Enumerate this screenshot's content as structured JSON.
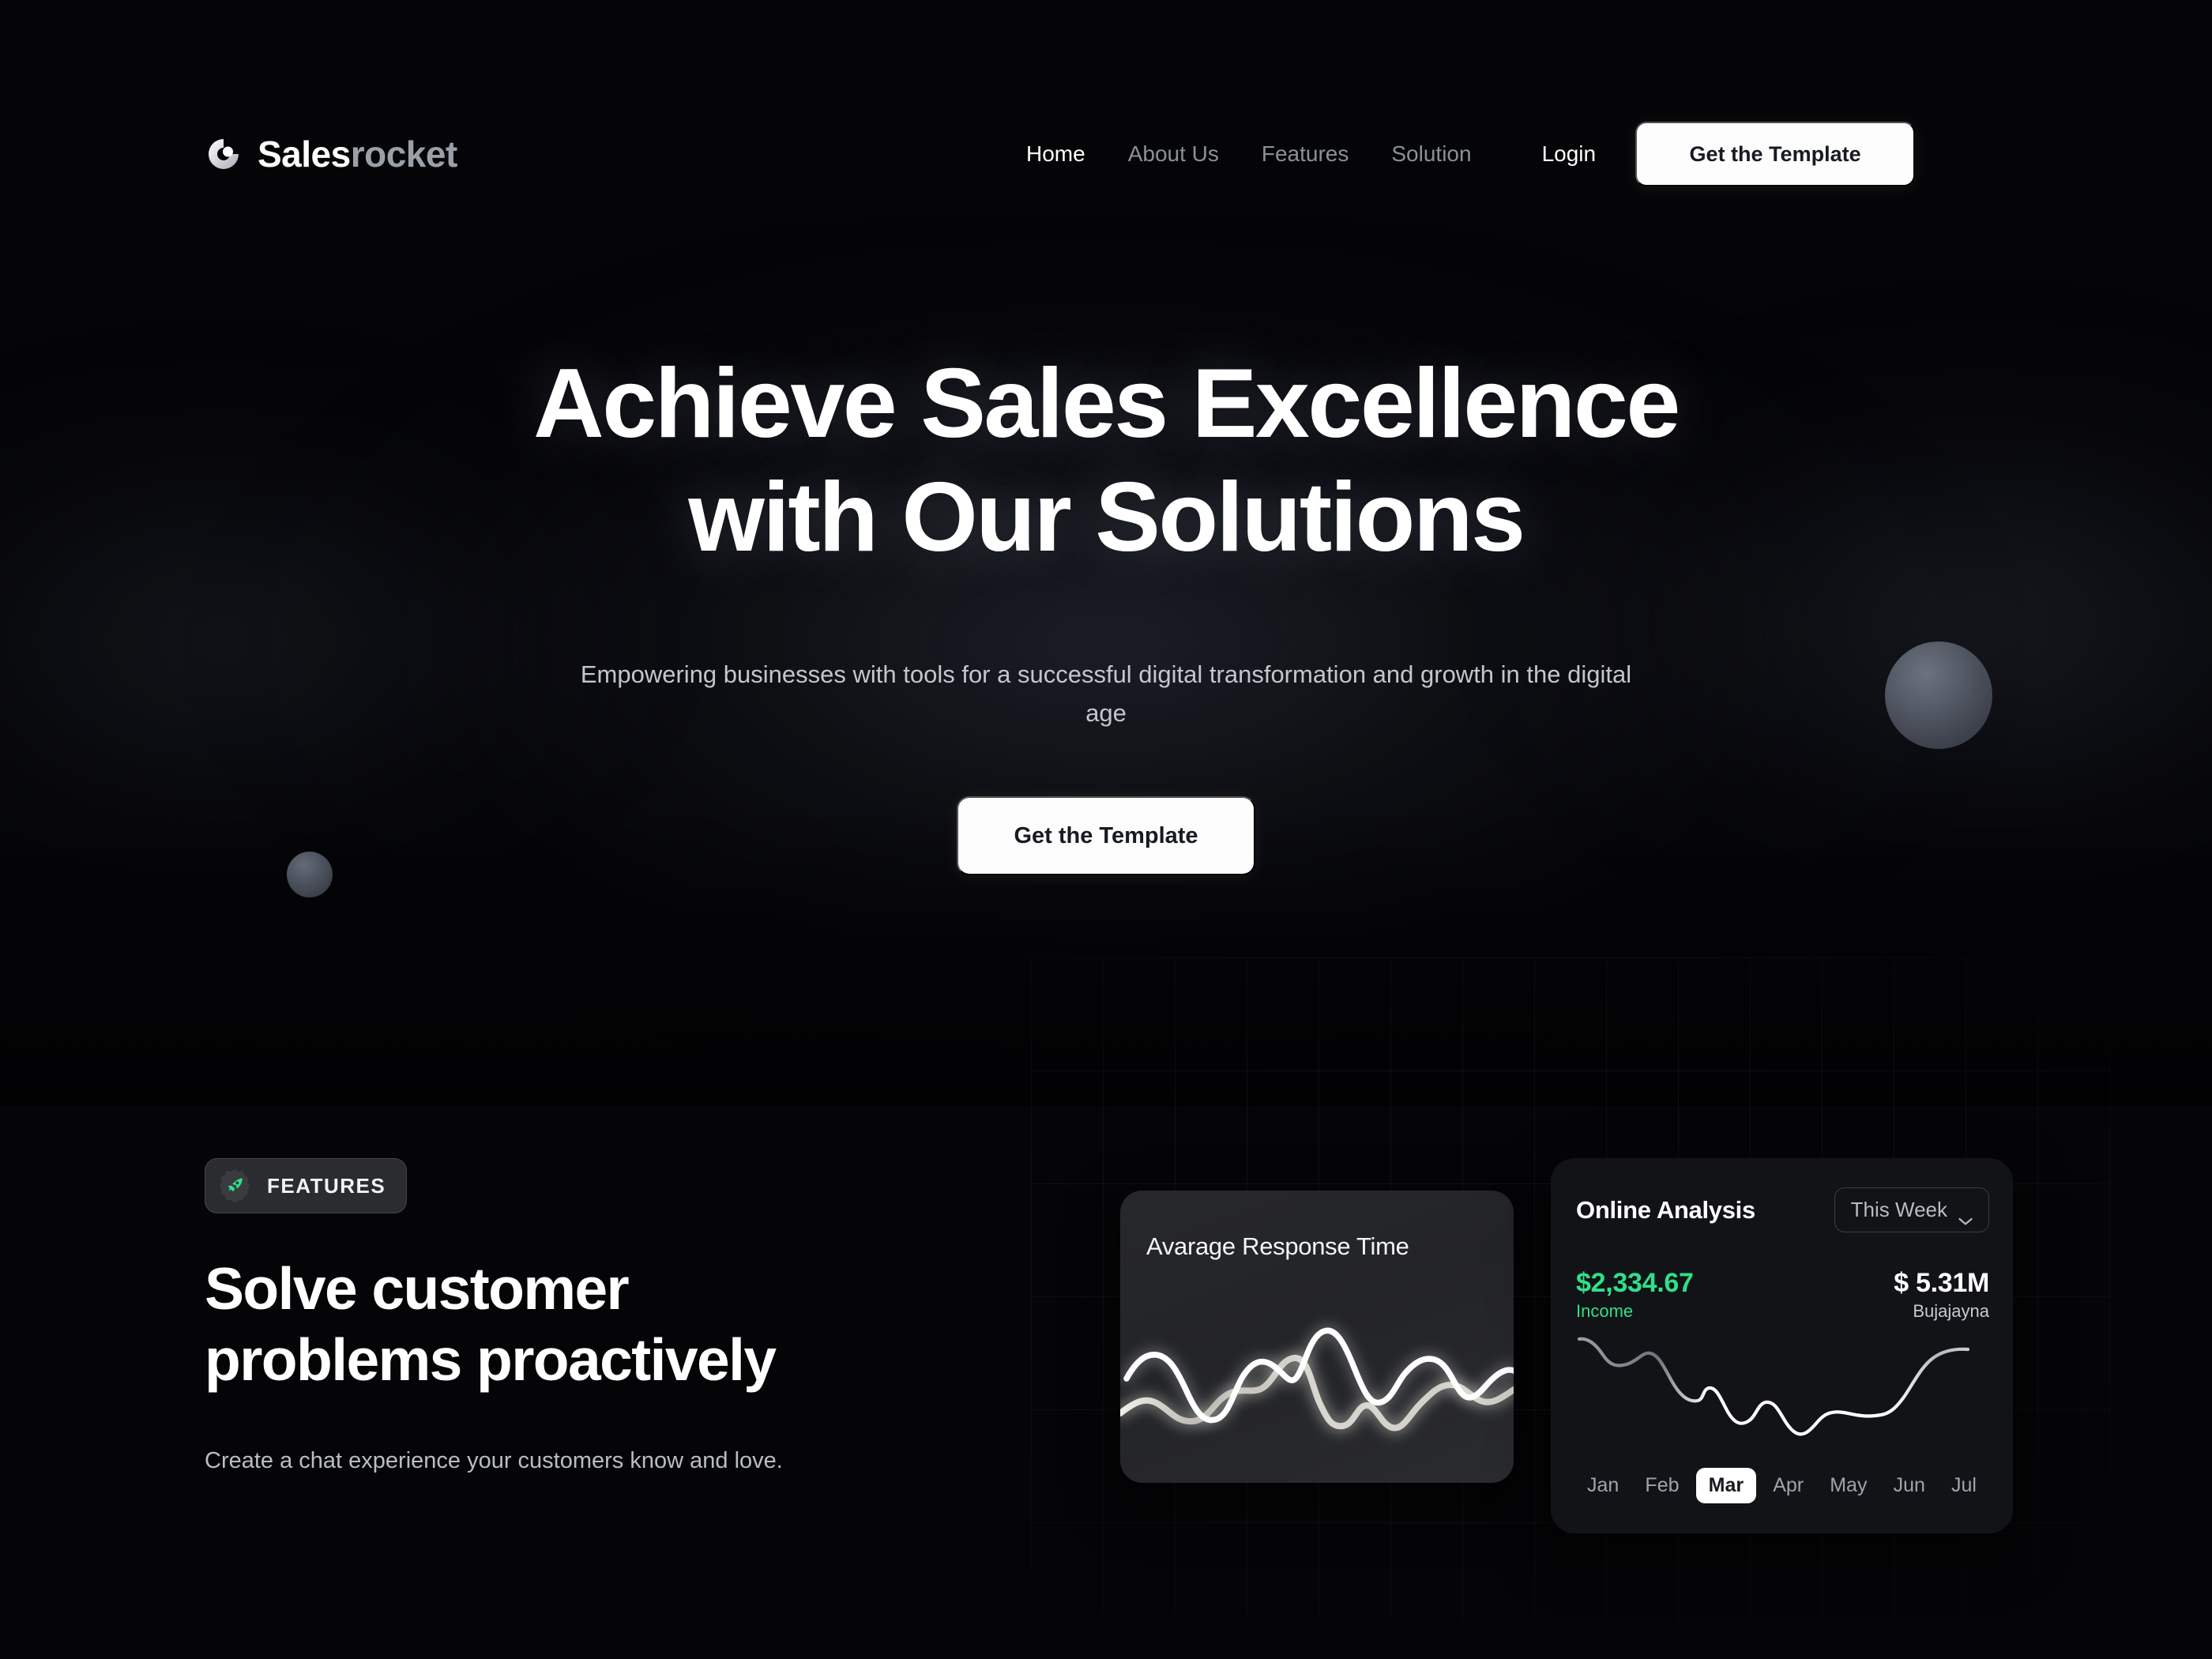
{
  "brand": {
    "name_primary": "Sales",
    "name_secondary": "rocket",
    "logo_icon": "rocket-circle-icon"
  },
  "nav": {
    "items": [
      {
        "label": "Home",
        "active": true
      },
      {
        "label": "About Us",
        "active": false
      },
      {
        "label": "Features",
        "active": false
      },
      {
        "label": "Solution",
        "active": false
      }
    ],
    "login_label": "Login",
    "cta_label": "Get the Template"
  },
  "hero": {
    "title_line1": "Achieve Sales Excellence",
    "title_line2": "with Our Solutions",
    "subtitle": "Empowering businesses with tools for a successful digital transformation and growth in the digital age",
    "cta_label": "Get the Template"
  },
  "features": {
    "badge_label": "FEATURES",
    "badge_icon": "rocket-icon",
    "title_line1": "Solve customer",
    "title_line2": "problems proactively",
    "description": "Create a chat experience your customers know and love."
  },
  "cards": {
    "response": {
      "title": "Avarage Response Time"
    },
    "analysis": {
      "title": "Online Analysis",
      "range_label": "This Week",
      "range_icon": "chevron-down-icon",
      "income_value": "$2,334.67",
      "income_label": "Income",
      "secondary_value": "$ 5.31M",
      "secondary_label": "Bujajayna",
      "months": [
        "Jan",
        "Feb",
        "Mar",
        "Apr",
        "May",
        "Jun",
        "Jul"
      ],
      "active_month": "Mar"
    }
  },
  "colors": {
    "background": "#050507",
    "accent_green": "#2fe08a",
    "text_primary": "#ffffff",
    "text_muted": "#8b9097",
    "button_bg": "#fdfdfd",
    "button_text": "#171a22",
    "card_dark": "#121317",
    "card_gray": "#27282b"
  },
  "chart_data": [
    {
      "type": "line",
      "title": "Avarage Response Time",
      "xlabel": "",
      "ylabel": "",
      "grid": false,
      "legend": "none",
      "series": [
        {
          "name": "white-wave",
          "values": [
            42,
            34,
            72,
            78,
            60,
            52,
            18,
            20,
            52,
            38,
            66,
            30,
            44,
            34,
            42
          ]
        },
        {
          "name": "gray-wave",
          "values": [
            70,
            64,
            80,
            66,
            60,
            44,
            86,
            80,
            94,
            82,
            70,
            58,
            72,
            58,
            50
          ]
        }
      ],
      "ylim": [
        0,
        100
      ]
    },
    {
      "type": "line",
      "title": "Online Analysis",
      "categories": [
        "Jan",
        "Feb",
        "Mar",
        "Apr",
        "May",
        "Jun",
        "Jul"
      ],
      "xlabel": "",
      "ylabel": "",
      "grid": false,
      "legend": "none",
      "series": [
        {
          "name": "revenue",
          "values": [
            92,
            84,
            80,
            62,
            56,
            40,
            46,
            30,
            22,
            34,
            38,
            40,
            56,
            80,
            84
          ]
        }
      ],
      "ylim": [
        0,
        100
      ]
    }
  ]
}
